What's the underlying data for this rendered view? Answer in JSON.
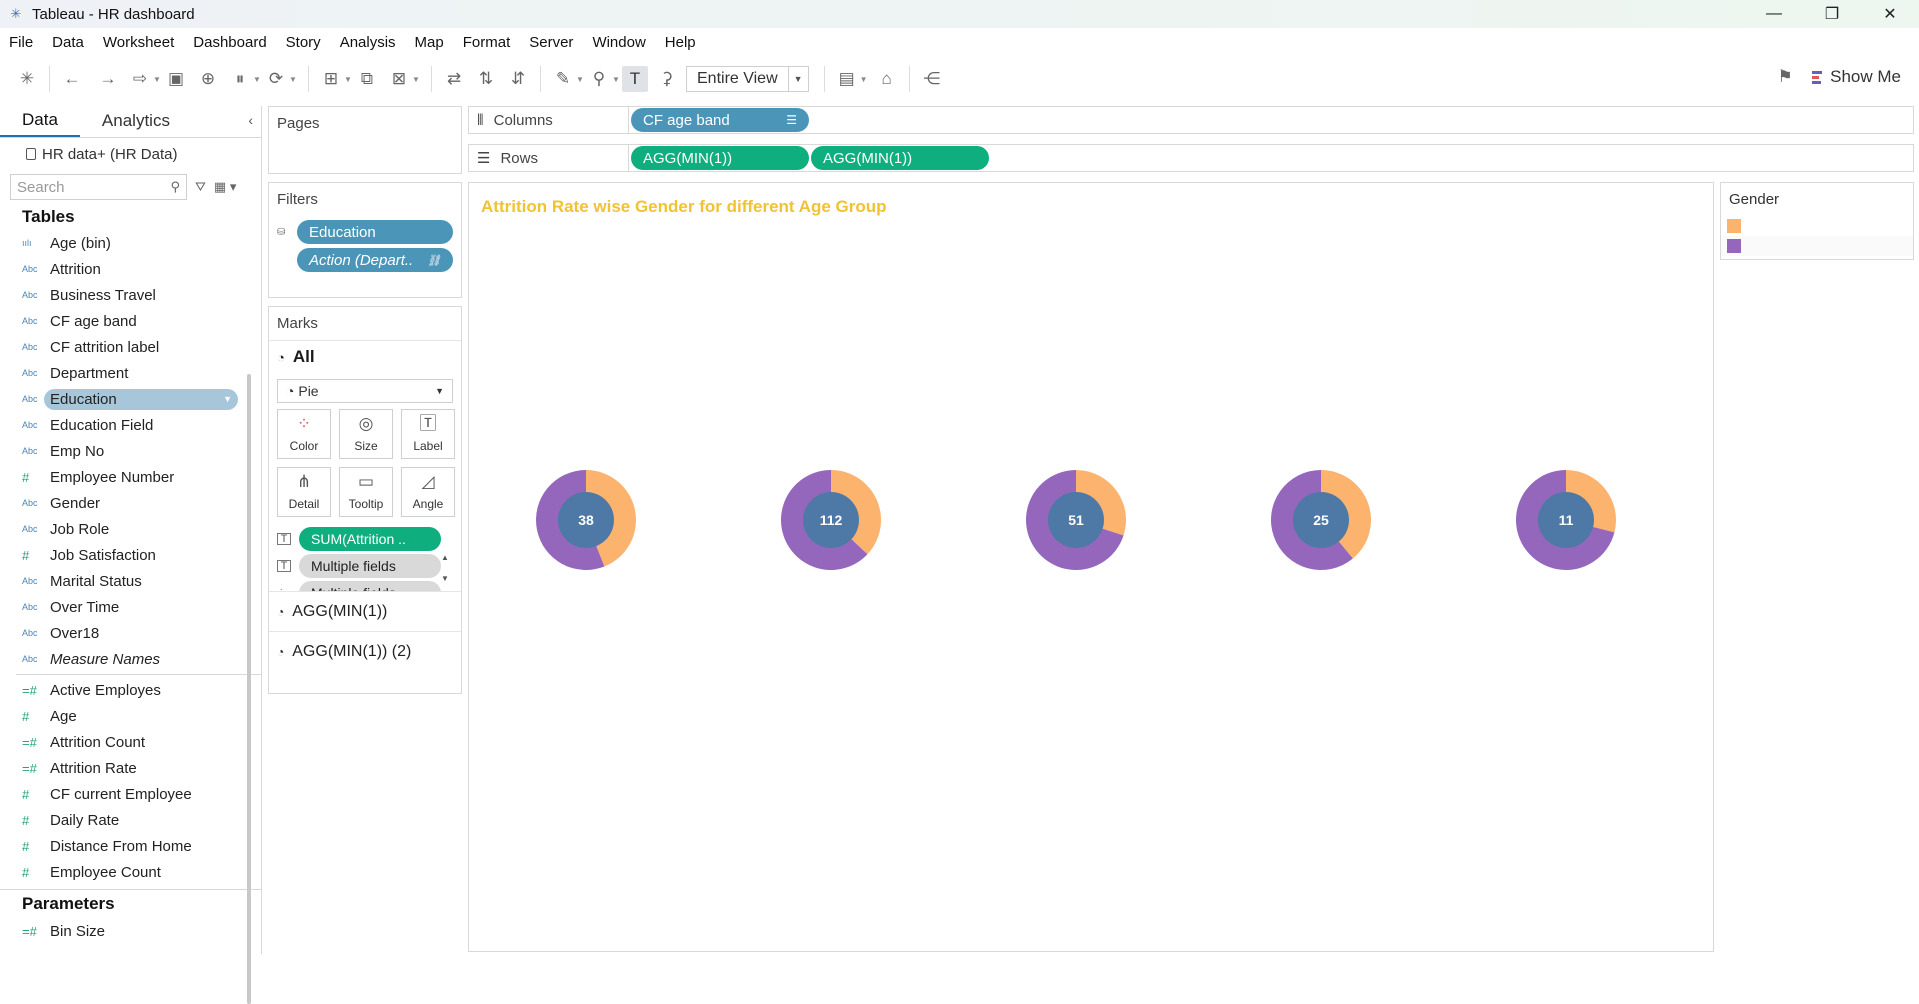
{
  "window": {
    "title": "Tableau - HR dashboard"
  },
  "menu": [
    "File",
    "Data",
    "Worksheet",
    "Dashboard",
    "Story",
    "Analysis",
    "Map",
    "Format",
    "Server",
    "Window",
    "Help"
  ],
  "toolbar": {
    "fit": "Entire View",
    "show_me": "Show Me"
  },
  "data_pane": {
    "tabs": [
      "Data",
      "Analytics"
    ],
    "datasource": "HR data+ (HR Data)",
    "search_placeholder": "Search",
    "tables_title": "Tables",
    "dimensions": [
      {
        "name": "Age (bin)",
        "type": "bin"
      },
      {
        "name": "Attrition",
        "type": "Abc"
      },
      {
        "name": "Business Travel",
        "type": "Abc"
      },
      {
        "name": "CF age band",
        "type": "Abc"
      },
      {
        "name": "CF attrition label",
        "type": "Abc"
      },
      {
        "name": "Department",
        "type": "Abc"
      },
      {
        "name": "Education",
        "type": "Abc",
        "selected": true
      },
      {
        "name": "Education Field",
        "type": "Abc"
      },
      {
        "name": "Emp No",
        "type": "Abc"
      },
      {
        "name": "Employee Number",
        "type": "#"
      },
      {
        "name": "Gender",
        "type": "Abc"
      },
      {
        "name": "Job Role",
        "type": "Abc"
      },
      {
        "name": "Job Satisfaction",
        "type": "#"
      },
      {
        "name": "Marital Status",
        "type": "Abc"
      },
      {
        "name": "Over Time",
        "type": "Abc"
      },
      {
        "name": "Over18",
        "type": "Abc"
      },
      {
        "name": "Measure Names",
        "type": "Abc",
        "italic": true
      }
    ],
    "measures": [
      {
        "name": "Active Employes",
        "type": "=#"
      },
      {
        "name": "Age",
        "type": "#"
      },
      {
        "name": "Attrition Count",
        "type": "=#"
      },
      {
        "name": "Attrition Rate",
        "type": "=#"
      },
      {
        "name": "CF current Employee",
        "type": "#"
      },
      {
        "name": "Daily Rate",
        "type": "#"
      },
      {
        "name": "Distance From Home",
        "type": "#"
      },
      {
        "name": "Employee Count",
        "type": "#"
      }
    ],
    "parameters_title": "Parameters",
    "parameters": [
      {
        "name": "Bin Size",
        "type": "=#"
      }
    ]
  },
  "cards": {
    "pages": "Pages",
    "filters": "Filters",
    "filter_pills": [
      "Education",
      "Action (Depart.."
    ],
    "marks": "Marks",
    "marks_all": "All",
    "mark_type": "Pie",
    "mark_buttons": [
      "Color",
      "Size",
      "Label",
      "Detail",
      "Tooltip",
      "Angle"
    ],
    "mark_fields": [
      "SUM(Attrition ..",
      "Multiple fields",
      "Multiple fields"
    ],
    "marks_sub": [
      "AGG(MIN(1))",
      "AGG(MIN(1)) (2)"
    ]
  },
  "shelves": {
    "columns_label": "Columns",
    "columns": [
      "CF age band"
    ],
    "rows_label": "Rows",
    "rows": [
      "AGG(MIN(1))",
      "AGG(MIN(1))"
    ]
  },
  "viz": {
    "title": "Attrition Rate wise Gender for different Age Group"
  },
  "legend": {
    "title": "Gender",
    "colors": [
      "#fbb36e",
      "#9467bd"
    ]
  },
  "chart_data": {
    "type": "pie",
    "title": "Attrition Rate wise Gender for different Age Group",
    "labels": [
      "38",
      "112",
      "51",
      "25",
      "11"
    ],
    "series": [
      {
        "color": "#fbb36e",
        "shares": [
          0.44,
          0.37,
          0.3,
          0.39,
          0.29
        ]
      },
      {
        "color": "#9467bd",
        "shares": [
          0.56,
          0.63,
          0.7,
          0.61,
          0.71
        ]
      }
    ],
    "center_color": "#4e79a7"
  }
}
